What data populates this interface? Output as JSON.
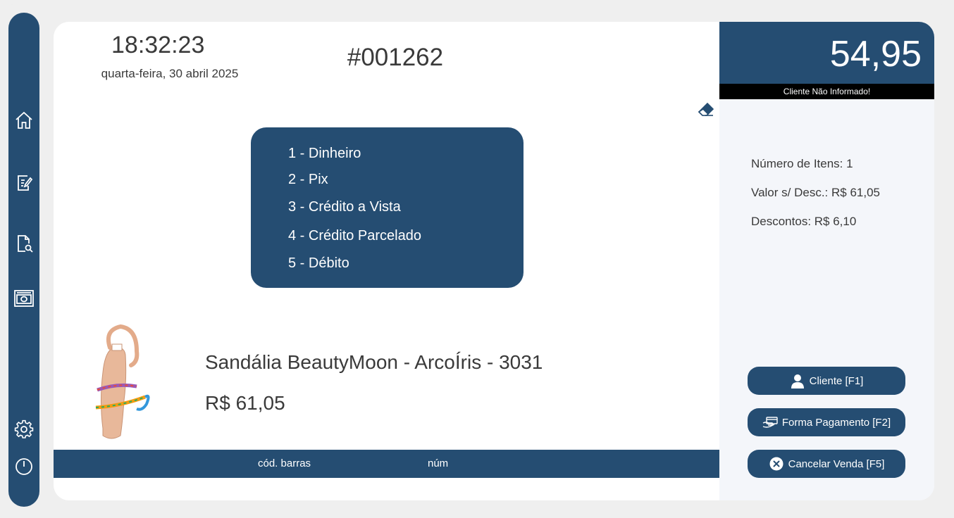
{
  "header": {
    "time": "18:32:23",
    "date": "quarta-feira, 30 abril 2025",
    "sale_number": "#001262"
  },
  "payment_menu": {
    "options": [
      "1 - Dinheiro",
      "2 - Pix",
      "3 - Crédito a Vista",
      "4 - Crédito Parcelado",
      "5 - Débito"
    ]
  },
  "product": {
    "name": "Sandália BeautyMoon - ArcoÍris - 3031",
    "price": "R$ 61,05"
  },
  "input_bar": {
    "barcode_label": "cód. barras",
    "number_label": "núm"
  },
  "summary": {
    "total": "54,95",
    "client_status": "Cliente Não Informado!",
    "items_count": "Número de Itens: 1",
    "value_no_discount": "Valor s/ Desc.: R$ 61,05",
    "discounts": "Descontos: R$ 6,10"
  },
  "actions": {
    "client": "Cliente [F1]",
    "payment": "Forma Pagamento [F2]",
    "cancel": "Cancelar Venda [F5]"
  },
  "sidebar": {
    "items": [
      "home-icon",
      "edit-document-icon",
      "search-document-icon",
      "cash-icon",
      "gear-icon",
      "power-icon"
    ]
  },
  "colors": {
    "primary": "#254d72",
    "panel": "#f4f6fa",
    "background": "#efefef"
  }
}
